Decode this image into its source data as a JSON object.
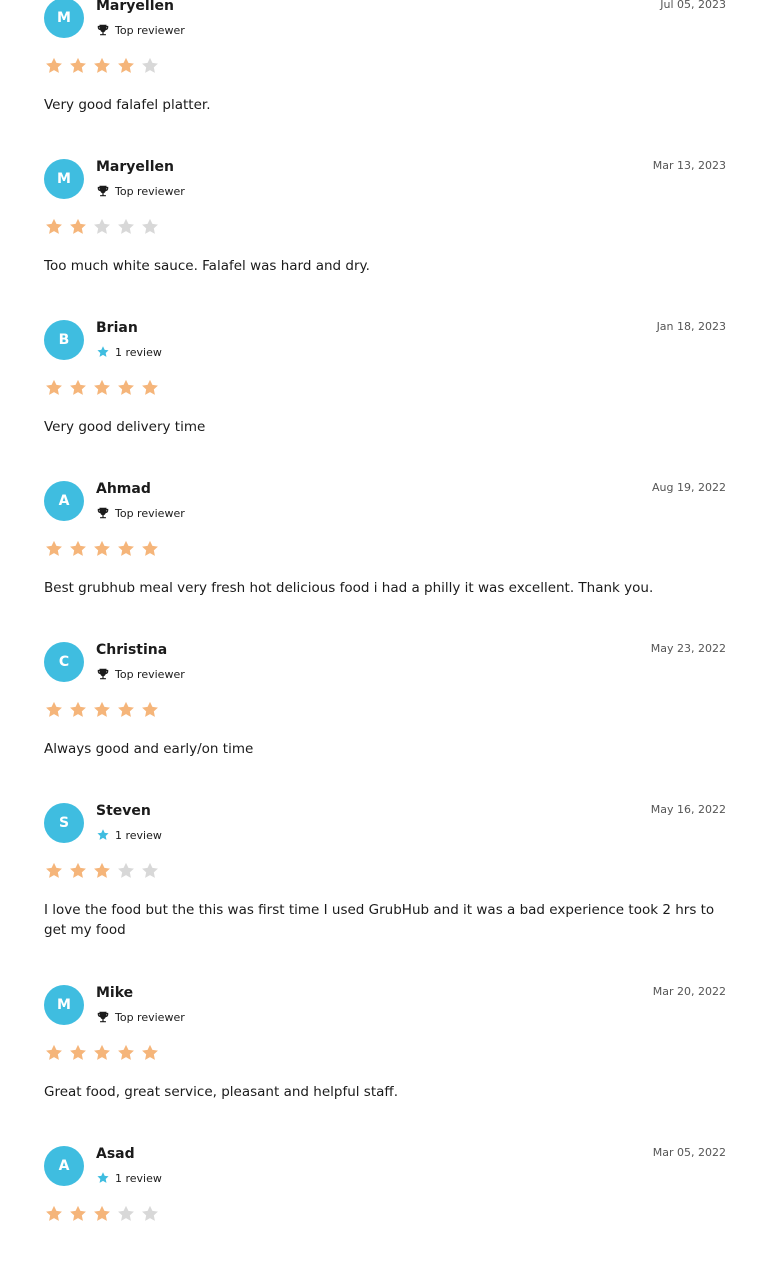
{
  "colors": {
    "avatar": "#3fbde0",
    "star_filled": "#f5b57a",
    "star_empty": "#d8d8d8",
    "badge_star": "#3fbde0",
    "text": "#1b1b1b"
  },
  "reviews": [
    {
      "initial": "M",
      "name": "Maryellen",
      "badge": "Top reviewer",
      "badge_icon": "trophy-icon",
      "date": "Jul 05, 2023",
      "rating": 4,
      "text": "Very good falafel platter."
    },
    {
      "initial": "M",
      "name": "Maryellen",
      "badge": "Top reviewer",
      "badge_icon": "trophy-icon",
      "date": "Mar 13, 2023",
      "rating": 2,
      "text": "Too much white sauce. Falafel was hard and dry."
    },
    {
      "initial": "B",
      "name": "Brian",
      "badge": "1 review",
      "badge_icon": "star-badge-icon",
      "date": "Jan 18, 2023",
      "rating": 5,
      "text": "Very good delivery time"
    },
    {
      "initial": "A",
      "name": "Ahmad",
      "badge": "Top reviewer",
      "badge_icon": "trophy-icon",
      "date": "Aug 19, 2022",
      "rating": 5,
      "text": "Best grubhub meal very fresh hot delicious food i had a philly it was excellent. Thank you."
    },
    {
      "initial": "C",
      "name": "Christina",
      "badge": "Top reviewer",
      "badge_icon": "trophy-icon",
      "date": "May 23, 2022",
      "rating": 5,
      "text": "Always good and early/on time"
    },
    {
      "initial": "S",
      "name": "Steven",
      "badge": "1 review",
      "badge_icon": "star-badge-icon",
      "date": "May 16, 2022",
      "rating": 3,
      "text": "I love the food but the this was first time I used GrubHub and it was a bad experience took 2 hrs to get my food"
    },
    {
      "initial": "M",
      "name": "Mike",
      "badge": "Top reviewer",
      "badge_icon": "trophy-icon",
      "date": "Mar 20, 2022",
      "rating": 5,
      "text": "Great food, great service, pleasant and helpful staff."
    },
    {
      "initial": "A",
      "name": "Asad",
      "badge": "1 review",
      "badge_icon": "star-badge-icon",
      "date": "Mar 05, 2022",
      "rating": 3,
      "text": ""
    }
  ]
}
